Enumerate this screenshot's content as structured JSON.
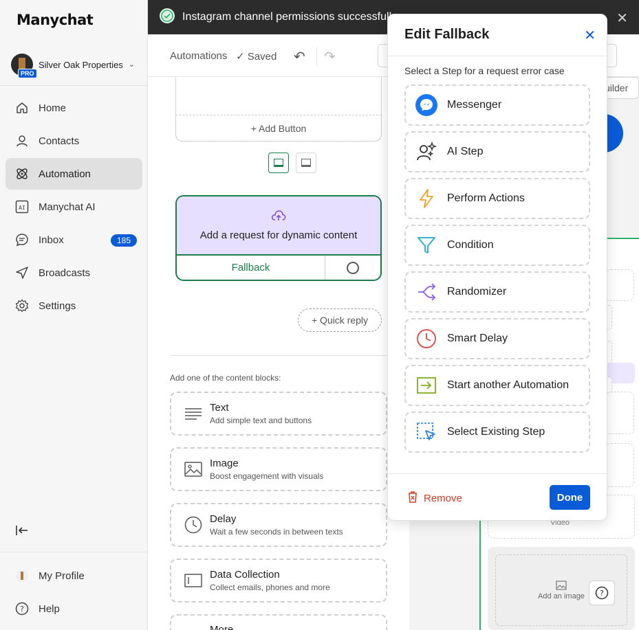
{
  "app": {
    "logo": "Manychat"
  },
  "account": {
    "name": "Silver Oak Properties",
    "badge": "PRO"
  },
  "nav": [
    {
      "label": "Home",
      "icon": "home-icon"
    },
    {
      "label": "Contacts",
      "icon": "person-icon"
    },
    {
      "label": "Automation",
      "icon": "atom-icon",
      "active": true
    },
    {
      "label": "Manychat AI",
      "icon": "ai-icon"
    },
    {
      "label": "Inbox",
      "icon": "chat-icon",
      "badge": "185"
    },
    {
      "label": "Broadcasts",
      "icon": "send-icon"
    },
    {
      "label": "Settings",
      "icon": "gear-icon"
    }
  ],
  "sidebar_bottom": {
    "profile": "My Profile",
    "help": "Help"
  },
  "toast": {
    "text": "Instagram channel permissions successfully r"
  },
  "toolbar": {
    "crumb": "Automations",
    "status": "Saved"
  },
  "canvas": {
    "add_button": "+ Add Button",
    "request_title": "Add a request for dynamic content",
    "fallback": "Fallback",
    "quick_reply": "+ Quick reply",
    "blocks_hint": "Add one of the content blocks:",
    "blocks": [
      {
        "title": "Text",
        "sub": "Add simple text and buttons",
        "icon": "text-lines-icon"
      },
      {
        "title": "Image",
        "sub": "Boost engagement with visuals",
        "icon": "image-icon"
      },
      {
        "title": "Delay",
        "sub": "Wait a few seconds in between texts",
        "icon": "clock-icon"
      },
      {
        "title": "Data Collection",
        "sub": "Collect emails, phones and more",
        "icon": "form-icon"
      },
      {
        "title": "More",
        "sub": "",
        "icon": "more-icon"
      }
    ],
    "builder_chip": "uilder",
    "video_label": "Video",
    "add_image": "Add an image"
  },
  "modal": {
    "title": "Edit Fallback",
    "subtitle": "Select a Step for a request error case",
    "steps": [
      {
        "label": "Messenger",
        "icon": "messenger-icon"
      },
      {
        "label": "AI Step",
        "icon": "ai-person-icon"
      },
      {
        "label": "Perform Actions",
        "icon": "lightning-icon"
      },
      {
        "label": "Condition",
        "icon": "filter-icon"
      },
      {
        "label": "Randomizer",
        "icon": "randomizer-icon"
      },
      {
        "label": "Smart Delay",
        "icon": "clock-icon"
      },
      {
        "label": "Start another Automation",
        "icon": "enter-arrow-icon"
      },
      {
        "label": "Select Existing Step",
        "icon": "cursor-select-icon"
      }
    ],
    "remove_label": "Remove",
    "done_label": "Done"
  },
  "colors": {
    "brand_blue": "#0a5bd8",
    "green": "#1a7d4a",
    "danger": "#d23a1f",
    "request_bg": "#e7dfff"
  }
}
